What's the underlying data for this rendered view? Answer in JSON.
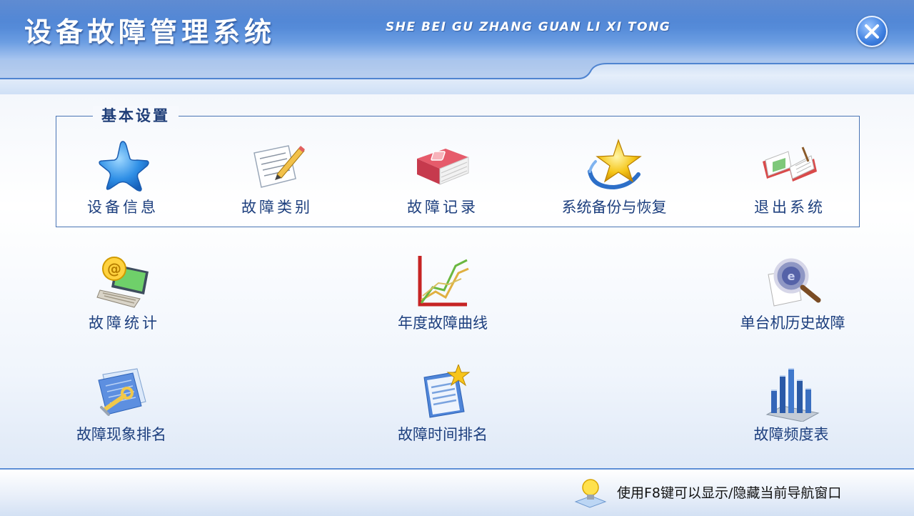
{
  "header": {
    "title": "设备故障管理系统",
    "subtitle": "SHE BEI GU ZHANG GUAN LI XI TONG"
  },
  "basic_settings": {
    "title": "基本设置",
    "items": [
      {
        "label": "设备信息",
        "icon": "blue-star-icon"
      },
      {
        "label": "故障类别",
        "icon": "notepad-pencil-icon"
      },
      {
        "label": "故障记录",
        "icon": "record-book-icon"
      },
      {
        "label": "系统备份与恢复",
        "icon": "gold-star-orbit-icon"
      },
      {
        "label": "退出系统",
        "icon": "open-book-icon"
      }
    ]
  },
  "modules": [
    {
      "label": "故障统计",
      "icon": "laptop-email-icon"
    },
    {
      "label": "年度故障曲线",
      "icon": "line-chart-icon"
    },
    {
      "label": "单台机历史故障",
      "icon": "magnifier-icon"
    },
    {
      "label": "故障现象排名",
      "icon": "wrench-document-icon"
    },
    {
      "label": "故障时间排名",
      "icon": "starred-document-icon"
    },
    {
      "label": "故障频度表",
      "icon": "bar-chart-icon"
    }
  ],
  "status": {
    "hint": "使用F8键可以显示/隐藏当前导航窗口",
    "icon": "lightbulb-icon"
  },
  "colors": {
    "header_blue": "#3c72c8",
    "label_blue": "#1d3f7e",
    "accent_border": "#4a74b4"
  }
}
